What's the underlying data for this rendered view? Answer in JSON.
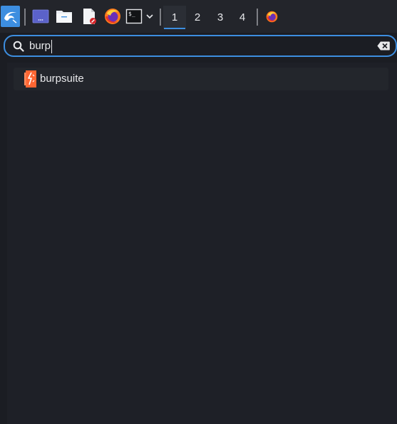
{
  "panel": {
    "launcher_icon": "kali-dragon-icon",
    "quick_launch": [
      {
        "name": "show-desktop-icon"
      },
      {
        "name": "file-manager-icon"
      },
      {
        "name": "text-editor-icon"
      },
      {
        "name": "firefox-icon"
      },
      {
        "name": "terminal-icon"
      }
    ],
    "workspaces": [
      "1",
      "2",
      "3",
      "4"
    ],
    "active_workspace": "1"
  },
  "search": {
    "query": "burp",
    "search_icon": "search-icon",
    "clear_icon": "clear-text-icon"
  },
  "results": [
    {
      "label": "burpsuite",
      "icon": "burpsuite-icon"
    }
  ],
  "colors": {
    "accent": "#3d8ee0",
    "panel_bg": "#23252b",
    "bg": "#1b1d23",
    "burp_orange": "#ff6633"
  }
}
